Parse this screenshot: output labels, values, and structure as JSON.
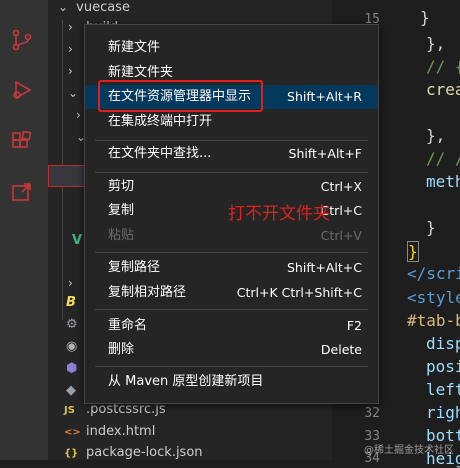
{
  "explorer": {
    "root_folder": "vuecase",
    "rows": [
      "build",
      ".postcssrc.js",
      "index.html",
      "package-lock.json"
    ]
  },
  "context_menu": {
    "items": [
      {
        "label": "新建文件",
        "shortcut": ""
      },
      {
        "label": "新建文件夹",
        "shortcut": ""
      },
      {
        "label": "在文件资源管理器中显示",
        "shortcut": "Shift+Alt+R"
      },
      {
        "label": "在集成终端中打开",
        "shortcut": ""
      },
      {
        "label": "在文件夹中查找...",
        "shortcut": "Shift+Alt+F"
      },
      {
        "label": "剪切",
        "shortcut": "Ctrl+X"
      },
      {
        "label": "复制",
        "shortcut": "Ctrl+C"
      },
      {
        "label": "粘贴",
        "shortcut": "Ctrl+V",
        "disabled": true
      },
      {
        "label": "复制路径",
        "shortcut": "Shift+Alt+C"
      },
      {
        "label": "复制相对路径",
        "shortcut": "Ctrl+K Ctrl+Shift+C"
      },
      {
        "label": "重命名",
        "shortcut": "F2"
      },
      {
        "label": "删除",
        "shortcut": "Delete"
      },
      {
        "label": "从 Maven 原型创建新项目",
        "shortcut": ""
      }
    ],
    "highlighted_item": "在文件资源管理器中显示"
  },
  "annotation": "打不开文件夹",
  "editor": {
    "line_numbers": [
      "15",
      "32",
      "33",
      "34"
    ],
    "code_lines": [
      "}",
      "},",
      "// {",
      "crea",
      "},",
      "// /",
      "meth",
      "}",
      "}",
      "</scri",
      "<style",
      "#tab-b",
      "disp",
      "posi",
      "left",
      "righ",
      "bott",
      "heig"
    ]
  },
  "watermark": "@稀土掘金技术社区",
  "colors": {
    "highlight": "#04395e",
    "annotation": "#e0201e",
    "menu_bg": "#252526"
  }
}
